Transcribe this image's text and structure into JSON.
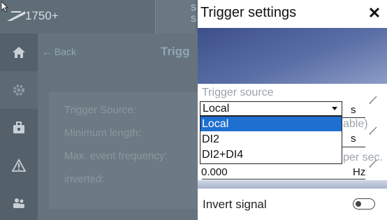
{
  "app": {
    "model": "1750+",
    "tab_fragment": "S\nS"
  },
  "background": {
    "back_label": "← Back",
    "page_title_fragment": "Trigg",
    "labels": [
      "Trigger Source:",
      "Minimum length:",
      "Max. event frequency:",
      "inverted:"
    ],
    "sidebar_icons": [
      "home-icon",
      "gear-icon",
      "toolbox-icon",
      "warning-icon",
      "users-icon"
    ]
  },
  "dialog": {
    "title": "Trigger settings",
    "close_label": "✕",
    "trigger_source": {
      "label": "Trigger source",
      "value": "Local",
      "unit": "s",
      "options": [
        "Local",
        "DI2",
        "DI2+DI4"
      ],
      "selected_index": 0
    },
    "min_length": {
      "label_fragment": "able)",
      "unit": "s"
    },
    "max_freq": {
      "label_fragment": "per sec.",
      "value": "0.000",
      "unit": "Hz"
    },
    "invert": {
      "label": "Invert signal",
      "on": false
    }
  },
  "colors": {
    "accent": "#1f6fd1",
    "banner": "#4a5f9a",
    "dim_bg": "#5e6a74"
  }
}
